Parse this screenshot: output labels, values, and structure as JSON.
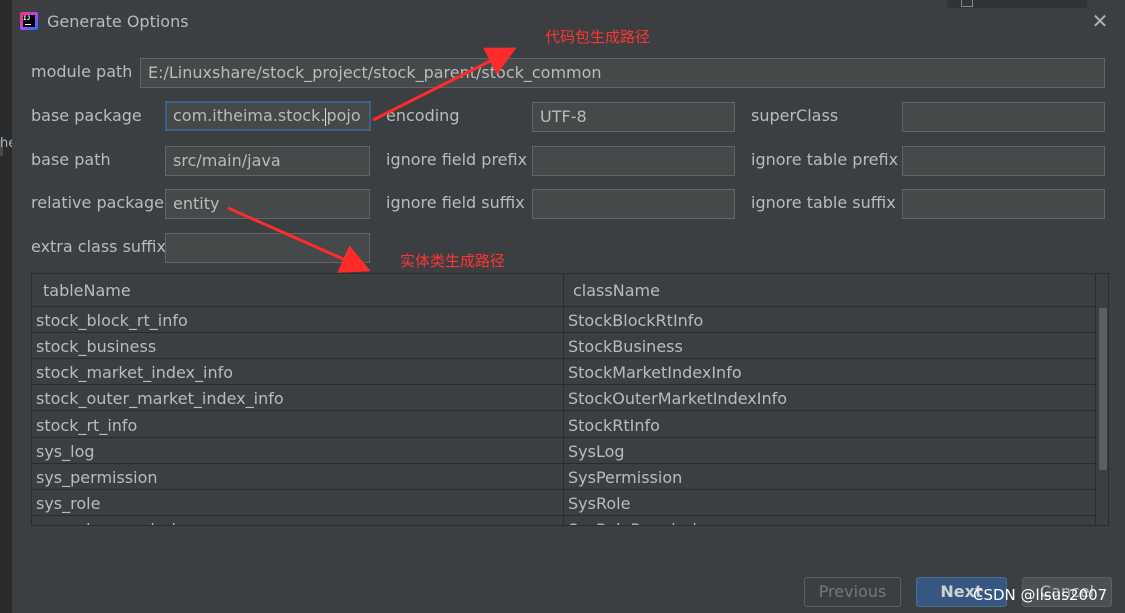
{
  "window": {
    "title": "Generate Options"
  },
  "background": {
    "peek_text": "he"
  },
  "form": {
    "module_path_label": "module path",
    "module_path_value": "E:/Linuxshare/stock_project/stock_parent/stock_common",
    "base_package_label": "base package",
    "base_package_value_before_caret": "com.itheima.stock.",
    "base_package_value_after_caret": "pojo",
    "encoding_label": "encoding",
    "encoding_value": "UTF-8",
    "superclass_label": "superClass",
    "superclass_value": "",
    "base_path_label": "base path",
    "base_path_value": "src/main/java",
    "ignore_field_prefix_label": "ignore field prefix",
    "ignore_field_prefix_value": "",
    "ignore_table_prefix_label": "ignore table prefix",
    "ignore_table_prefix_value": "",
    "relative_package_label": "relative package",
    "relative_package_value": "entity",
    "ignore_field_suffix_label": "ignore field suffix",
    "ignore_field_suffix_value": "",
    "ignore_table_suffix_label": "ignore table suffix",
    "ignore_table_suffix_value": "",
    "extra_class_suffix_label": "extra class suffix",
    "extra_class_suffix_value": ""
  },
  "table": {
    "columns": [
      "tableName",
      "className"
    ],
    "rows": [
      [
        "stock_block_rt_info",
        "StockBlockRtInfo"
      ],
      [
        "stock_business",
        "StockBusiness"
      ],
      [
        "stock_market_index_info",
        "StockMarketIndexInfo"
      ],
      [
        "stock_outer_market_index_info",
        "StockOuterMarketIndexInfo"
      ],
      [
        "stock_rt_info",
        "StockRtInfo"
      ],
      [
        "sys_log",
        "SysLog"
      ],
      [
        "sys_permission",
        "SysPermission"
      ],
      [
        "sys_role",
        "SysRole"
      ],
      [
        "sys_role_permission",
        "SysRolePermission"
      ]
    ]
  },
  "buttons": {
    "previous": "Previous",
    "next": "Next",
    "cancel": "Cancel"
  },
  "annotations": {
    "code_package_path": "代码包生成路径",
    "entity_class_path": "实体类生成路径",
    "color": "#ff2b2b"
  },
  "watermark": "CSDN @lisus2007"
}
